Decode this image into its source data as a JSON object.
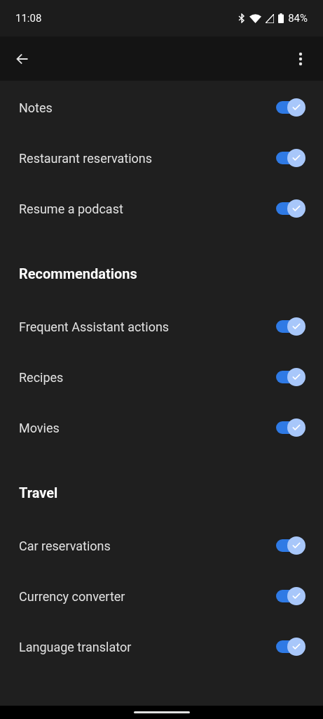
{
  "status_bar": {
    "time": "11:08",
    "battery": "84%"
  },
  "sections": [
    {
      "items": [
        {
          "label": "Notes",
          "on": true
        },
        {
          "label": "Restaurant reservations",
          "on": true
        },
        {
          "label": "Resume a podcast",
          "on": true
        }
      ]
    },
    {
      "title": "Recommendations",
      "items": [
        {
          "label": "Frequent Assistant actions",
          "on": true
        },
        {
          "label": "Recipes",
          "on": true
        },
        {
          "label": "Movies",
          "on": true
        }
      ]
    },
    {
      "title": "Travel",
      "items": [
        {
          "label": "Car reservations",
          "on": true
        },
        {
          "label": "Currency converter",
          "on": true
        },
        {
          "label": "Language translator",
          "on": true
        }
      ]
    }
  ]
}
